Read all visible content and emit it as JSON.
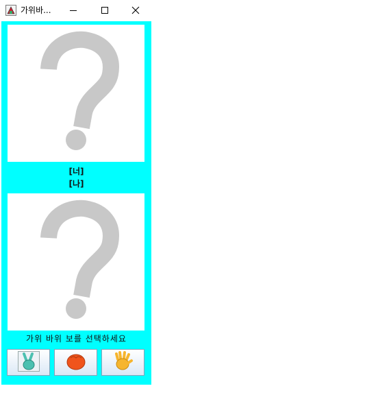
{
  "window": {
    "title": "가위바..."
  },
  "game": {
    "you_label": "[너]",
    "me_label": "[나]",
    "instruction": "가위 바위 보를 선택하세요"
  },
  "icons": {
    "app": "app-icon",
    "minimize": "minimize-icon",
    "maximize": "maximize-icon",
    "close": "close-icon",
    "unknown": "question-mark-icon",
    "scissors": "scissors-hand-icon",
    "rock": "rock-fist-icon",
    "paper": "paper-open-hand-icon"
  },
  "colors": {
    "background": "#00ffff",
    "question": "#c8c8c8"
  }
}
